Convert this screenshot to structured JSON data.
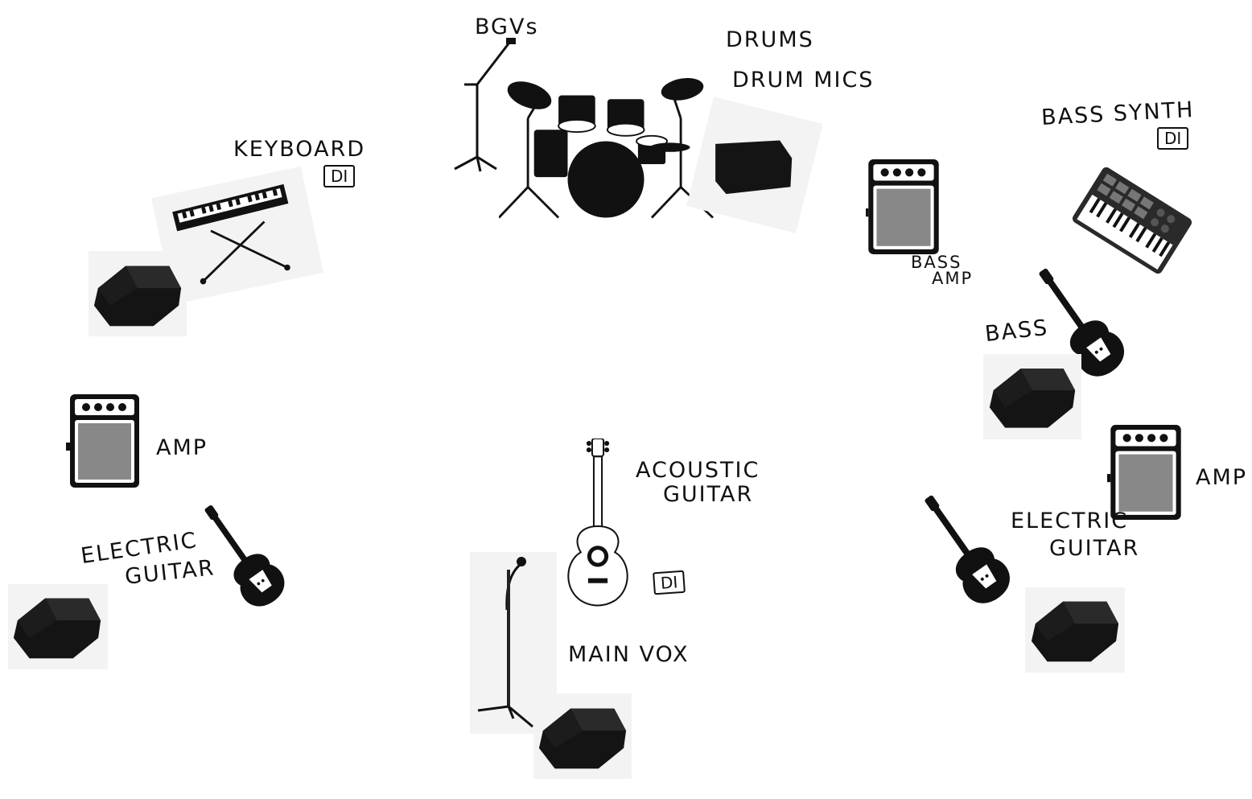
{
  "labels": {
    "bgvs": "BGVs",
    "drums": "DRUMS",
    "drum_mics": "DRUM MICS",
    "keyboard": "KEYBOARD",
    "keyboard_di": "DI",
    "bass_synth": "BASS SYNTH",
    "bass_synth_di": "DI",
    "bass_amp_line1": "BASS",
    "bass_amp_line2": "AMP",
    "bass": "BASS",
    "left_amp": "AMP",
    "left_guitar_line1": "ELECTRIC",
    "left_guitar_line2": "GUITAR",
    "acoustic_line1": "ACOUSTIC",
    "acoustic_line2": "GUITAR",
    "acoustic_di": "DI",
    "main_vox": "MAIN VOX",
    "right_amp": "AMP",
    "right_guitar_line1": "ELECTRIC",
    "right_guitar_line2": "GUITAR"
  },
  "icons": {
    "mic_stand": "mic-stand-icon",
    "drum_kit": "drum-kit-icon",
    "keyboard": "keyboard-icon",
    "synth": "midi-synth-icon",
    "amp": "guitar-amp-icon",
    "electric_guitar": "electric-guitar-icon",
    "acoustic_guitar": "acoustic-guitar-icon",
    "wedge": "floor-monitor-wedge-icon"
  },
  "colors": {
    "ink": "#111111",
    "panel": "#f3f3f3",
    "background": "#ffffff"
  }
}
